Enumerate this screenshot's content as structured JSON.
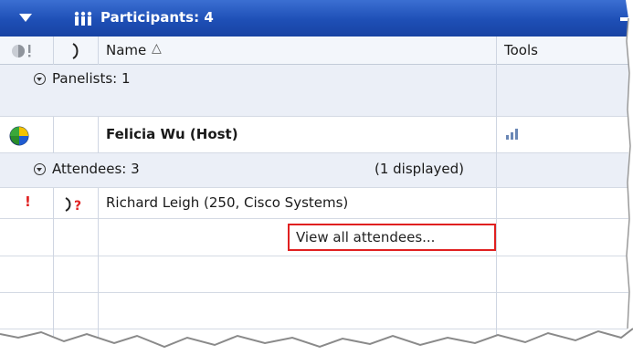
{
  "header": {
    "title": "Participants: 4"
  },
  "columns": {
    "name": "Name",
    "name_sort_glyph": "△",
    "tools": "Tools"
  },
  "panelists_group": {
    "label": "Panelists: 1"
  },
  "host": {
    "name": "Felicia  Wu (Host)"
  },
  "attendees_group": {
    "label": "Attendees: 3",
    "displayed": "(1 displayed)"
  },
  "attendee": {
    "alert_glyph": "!",
    "name": "Richard Leigh (250, Cisco Systems)"
  },
  "view_all": {
    "label": "View all attendees..."
  },
  "colors": {
    "titlebar": "#1e4fb6",
    "group_row": "#ebeff7",
    "alert": "#e02020",
    "highlight_box": "#e02020"
  }
}
